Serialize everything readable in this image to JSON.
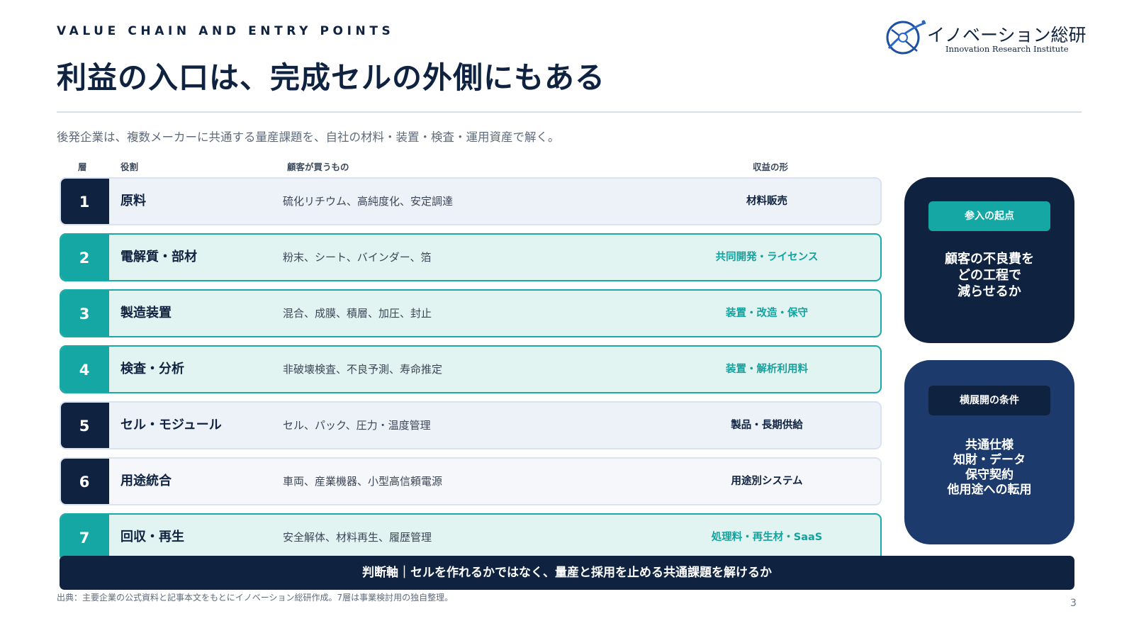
{
  "header": {
    "kicker": "VALUE CHAIN AND ENTRY POINTS",
    "title": "利益の入口は、完成セルの外側にもある",
    "lede": "後発企業は、複数メーカーに共通する量産課題を、自社の材料・装置・検査・運用資産で解く。"
  },
  "logo": {
    "name_jp": "イノベーション総研",
    "name_en": "Innovation Research Institute"
  },
  "table": {
    "columns": {
      "layer": "層",
      "role": "役割",
      "buys": "顧客が買うもの",
      "revenue": "収益の形"
    },
    "rows": [
      {
        "num": "1",
        "role": "原料",
        "buys": "硫化リチウム、高純度化、安定調達",
        "revenue": "材料販売",
        "style": "plain"
      },
      {
        "num": "2",
        "role": "電解質・部材",
        "buys": "粉末、シート、バインダー、箔",
        "revenue": "共同開発・ライセンス",
        "style": "teal"
      },
      {
        "num": "3",
        "role": "製造装置",
        "buys": "混合、成膜、積層、加圧、封止",
        "revenue": "装置・改造・保守",
        "style": "teal"
      },
      {
        "num": "4",
        "role": "検査・分析",
        "buys": "非破壊検査、不良予測、寿命推定",
        "revenue": "装置・解析利用料",
        "style": "teal"
      },
      {
        "num": "5",
        "role": "セル・モジュール",
        "buys": "セル、パック、圧力・温度管理",
        "revenue": "製品・長期供給",
        "style": "plain"
      },
      {
        "num": "6",
        "role": "用途統合",
        "buys": "車両、産業機器、小型高信頼電源",
        "revenue": "用途別システム",
        "style": "white"
      },
      {
        "num": "7",
        "role": "回収・再生",
        "buys": "安全解体、材料再生、履歴管理",
        "revenue": "処理料・再生材・SaaS",
        "style": "teal"
      }
    ]
  },
  "cards": {
    "entry": {
      "chip": "参入の起点",
      "lines": [
        "顧客の不良費を",
        "どの工程で",
        "減らせるか"
      ]
    },
    "expansion": {
      "chip": "横展開の条件",
      "lines": [
        "共通仕様",
        "知財・データ",
        "保守契約",
        "他用途への転用"
      ]
    }
  },
  "banner": "判断軸｜セルを作れるかではなく、量産と採用を止める共通課題を解けるか",
  "source": "出典：主要企業の公式資料と記事本文をもとにイノベーション総研作成。7層は事業検討用の独自整理。",
  "page_number": "3",
  "colors": {
    "navy": "#0f2340",
    "teal": "#14a7a3",
    "card_blue": "#1c3a6b"
  }
}
